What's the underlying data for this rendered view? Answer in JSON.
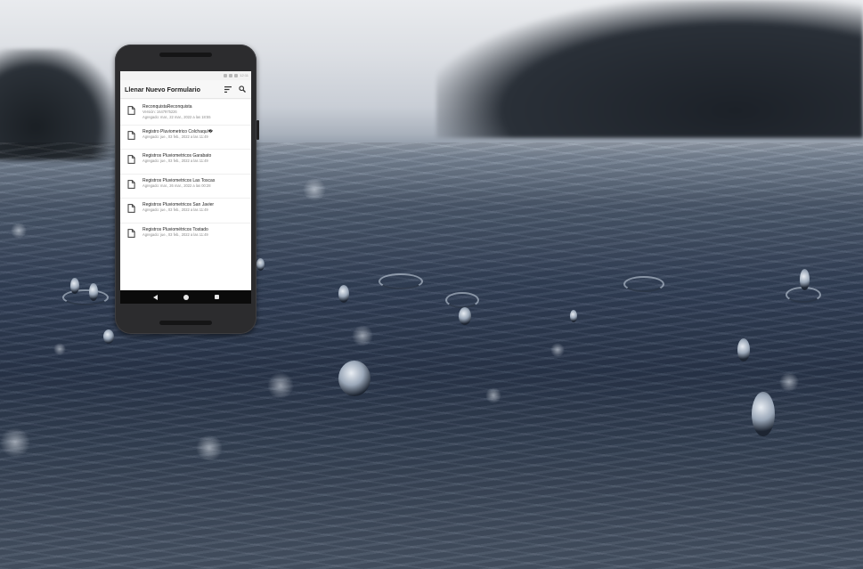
{
  "app": {
    "title": "Llenar Nuevo Formulario",
    "status_time": "12:11",
    "toolbar_icons": [
      "sort-icon",
      "search-icon"
    ]
  },
  "forms": [
    {
      "title": "ReconquistaReconquista",
      "version": "Versión: 1647975226",
      "added": "Agregado: mar., 22 mar., 2022 a las 18:55"
    },
    {
      "title": "Registro Pluviometrico Colchaquí�",
      "version": "",
      "added": "Agregado: jue., 03 feb., 2022 a las 11:49"
    },
    {
      "title": "Registros Pluviometricos Garabato",
      "version": "",
      "added": "Agregado: jue., 03 feb., 2022 a las 11:49"
    },
    {
      "title": "Registros Pluviometricos Las Toscas",
      "version": "",
      "added": "Agregado: mar., 26 mar., 2022 a las 00:28"
    },
    {
      "title": "Registros Pluviometricos San Javier",
      "version": "",
      "added": "Agregado: jue., 03 feb., 2022 a las 11:49"
    },
    {
      "title": "Registros Pluviométricos Tostado",
      "version": "",
      "added": "Agregado: jue., 03 feb., 2022 a las 11:49"
    }
  ],
  "navbar": [
    "back-icon",
    "home-icon",
    "recents-icon"
  ],
  "colors": {
    "appbar": "#f7f7f7",
    "navbar": "#0b0b0b",
    "phone_body": "#2c2c2e"
  }
}
